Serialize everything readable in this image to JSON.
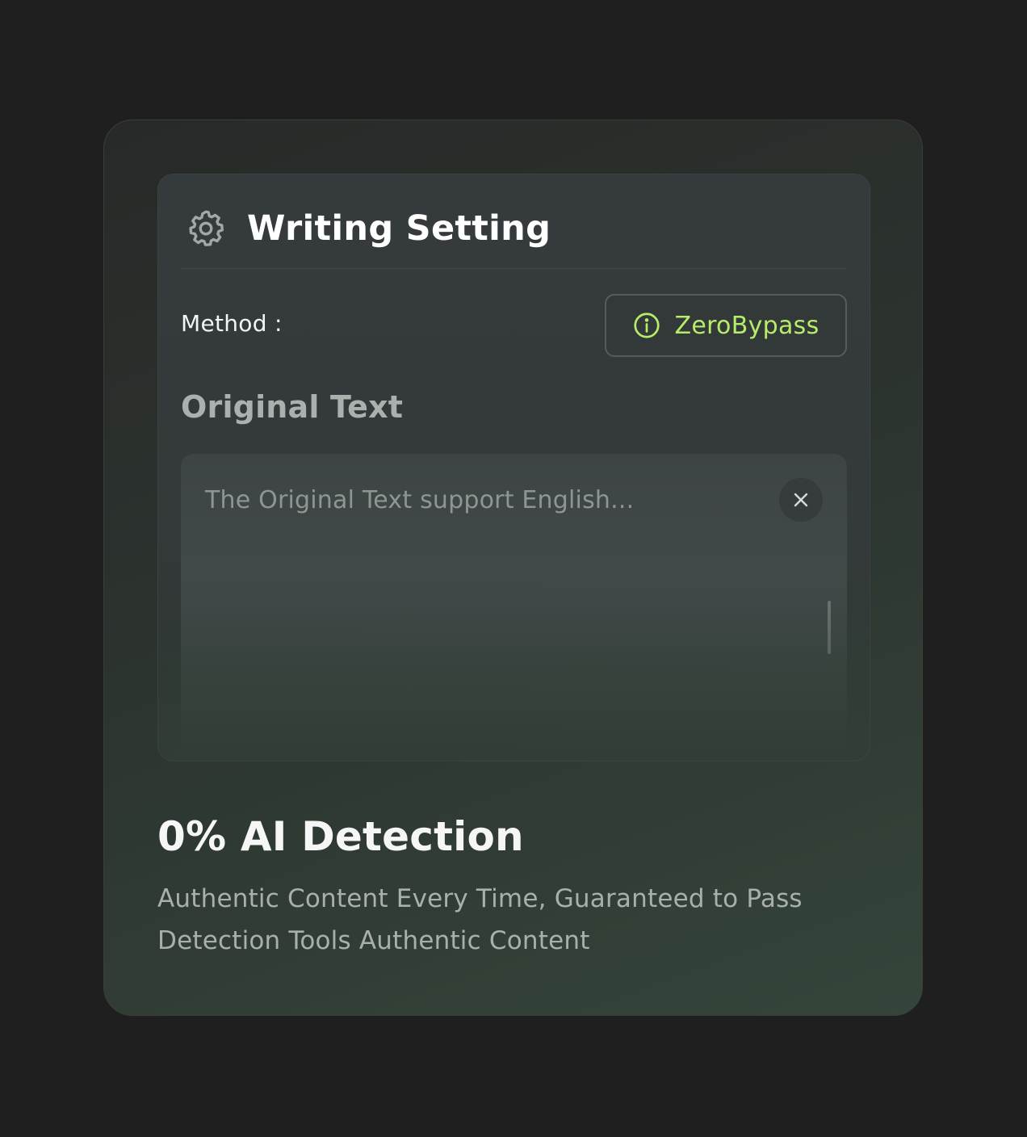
{
  "settings": {
    "title": "Writing Setting",
    "icon": "gear-icon",
    "method_label": "Method :",
    "method_value": "ZeroBypass",
    "method_icon": "info-icon"
  },
  "original_text": {
    "section_title": "Original Text",
    "placeholder": "The Original Text support English...",
    "clear_icon": "close-icon"
  },
  "feature": {
    "title": "0% AI Detection",
    "description": "Authentic Content Every Time, Guaranteed to Pass Detection Tools Authentic Content"
  },
  "colors": {
    "background": "#201f1f",
    "accent": "#b7ec6a",
    "card": "#2c332f"
  }
}
